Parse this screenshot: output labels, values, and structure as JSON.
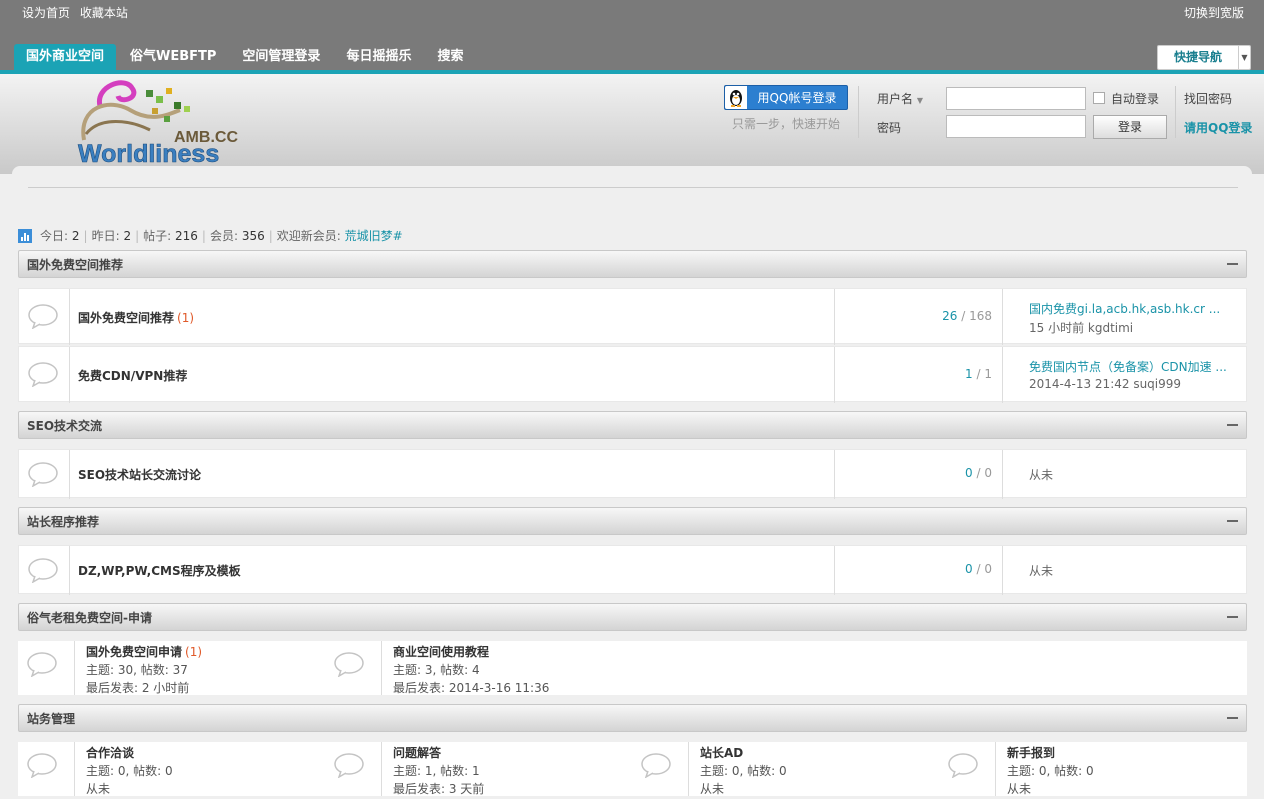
{
  "topbar": {
    "set_home": "设为首页",
    "bookmark": "收藏本站",
    "switch_width": "切换到宽版"
  },
  "nav": {
    "tabs": [
      {
        "label": "国外商业空间",
        "active": true
      },
      {
        "label": "俗气WEBFTP",
        "active": false
      },
      {
        "label": "空间管理登录",
        "active": false
      },
      {
        "label": "每日摇摇乐",
        "active": false
      },
      {
        "label": "搜索",
        "active": false
      }
    ],
    "quick_nav": "快捷导航"
  },
  "logo": {
    "text_top": "AMB.CC",
    "text_main": "Worldliness"
  },
  "login": {
    "qq_button": "用QQ帐号登录",
    "qq_hint": "只需一步，快速开始",
    "username_label": "用户名",
    "password_label": "密码",
    "auto_login": "自动登录",
    "login_button": "登录",
    "find_password": "找回密码",
    "qq_login_link": "请用QQ登录"
  },
  "stats": {
    "today_label": "今日:",
    "today": "2",
    "yesterday_label": "昨日:",
    "yesterday": "2",
    "posts_label": "帖子:",
    "posts": "216",
    "members_label": "会员:",
    "members": "356",
    "welcome_label": "欢迎新会员:",
    "new_member": "荒城旧梦#"
  },
  "categories": [
    {
      "title": "国外免费空间推荐",
      "forums": [
        {
          "name": "国外免费空间推荐",
          "today": "(1)",
          "threads": "26",
          "posts": "168",
          "last_title": "国内免费gi.la,acb.hk,asb.hk.cr ...",
          "last_meta": "15 小时前 kgdtimi"
        },
        {
          "name": "免费CDN/VPN推荐",
          "today": "",
          "threads": "1",
          "posts": "1",
          "last_title": "免费国内节点（免备案）CDN加速 ...",
          "last_meta": "2014-4-13 21:42 suqi999"
        }
      ]
    },
    {
      "title": "SEO技术交流",
      "forums": [
        {
          "name": "SEO技术站长交流讨论",
          "today": "",
          "threads": "0",
          "posts": "0",
          "never": "从未"
        }
      ]
    },
    {
      "title": "站长程序推荐",
      "forums": [
        {
          "name": "DZ,WP,PW,CMS程序及模板",
          "today": "",
          "threads": "0",
          "posts": "0",
          "never": "从未"
        }
      ]
    },
    {
      "title": "俗气老租免费空间-申请",
      "grid": [
        {
          "name": "国外免费空间申请",
          "today": "(1)",
          "stats": "主题: 30, 帖数: 37",
          "last": "最后发表: 2 小时前"
        },
        {
          "name": "商业空间使用教程",
          "today": "",
          "stats": "主题: 3, 帖数: 4",
          "last": "最后发表: 2014-3-16 11:36"
        }
      ]
    },
    {
      "title": "站务管理",
      "grid": [
        {
          "name": "合作洽谈",
          "today": "",
          "stats": "主题: 0, 帖数: 0",
          "last": "从未"
        },
        {
          "name": "问题解答",
          "today": "",
          "stats": "主题: 1, 帖数: 1",
          "last": "最后发表: 3 天前"
        },
        {
          "name": "站长AD",
          "today": "",
          "stats": "主题: 0, 帖数: 0",
          "last": "从未"
        },
        {
          "name": "新手报到",
          "today": "",
          "stats": "主题: 0, 帖数: 0",
          "last": "从未"
        }
      ]
    }
  ],
  "colors": {
    "accent": "#1ba3b5",
    "topbar": "#7a7a7a",
    "link": "#1a93a8",
    "today": "#e05a2a"
  },
  "icons": {
    "forum": "speech-bubble-icon",
    "stats": "bar-chart-icon",
    "collapse": "minus-icon",
    "qq": "penguin-icon"
  }
}
